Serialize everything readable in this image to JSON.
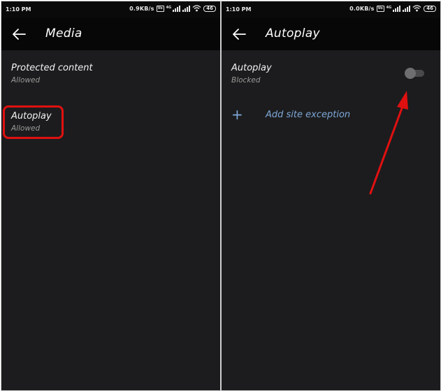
{
  "screens": [
    {
      "status": {
        "time": "1:10 PM",
        "speed": "0.9KB/s",
        "volte": "Vo",
        "network": "4G",
        "battery": "46"
      },
      "appbar": {
        "title": "Media",
        "back_icon": "arrow-left-icon"
      },
      "items": [
        {
          "title": "Protected content",
          "subtitle": "Allowed"
        },
        {
          "title": "Autoplay",
          "subtitle": "Allowed",
          "highlighted": true
        }
      ]
    },
    {
      "status": {
        "time": "1:10 PM",
        "speed": "0.0KB/s",
        "volte": "Vo",
        "network": "4G",
        "battery": "46"
      },
      "appbar": {
        "title": "Autoplay",
        "back_icon": "arrow-left-icon"
      },
      "setting": {
        "title": "Autoplay",
        "subtitle": "Blocked",
        "toggle_on": false
      },
      "add_exception": {
        "label": "Add site exception",
        "icon": "plus-icon"
      }
    }
  ],
  "colors": {
    "background": "#1c1c1e",
    "appbar": "#070707",
    "highlight": "#e01010",
    "annotation_arrow": "#e01010",
    "link": "#7fa8d8"
  }
}
